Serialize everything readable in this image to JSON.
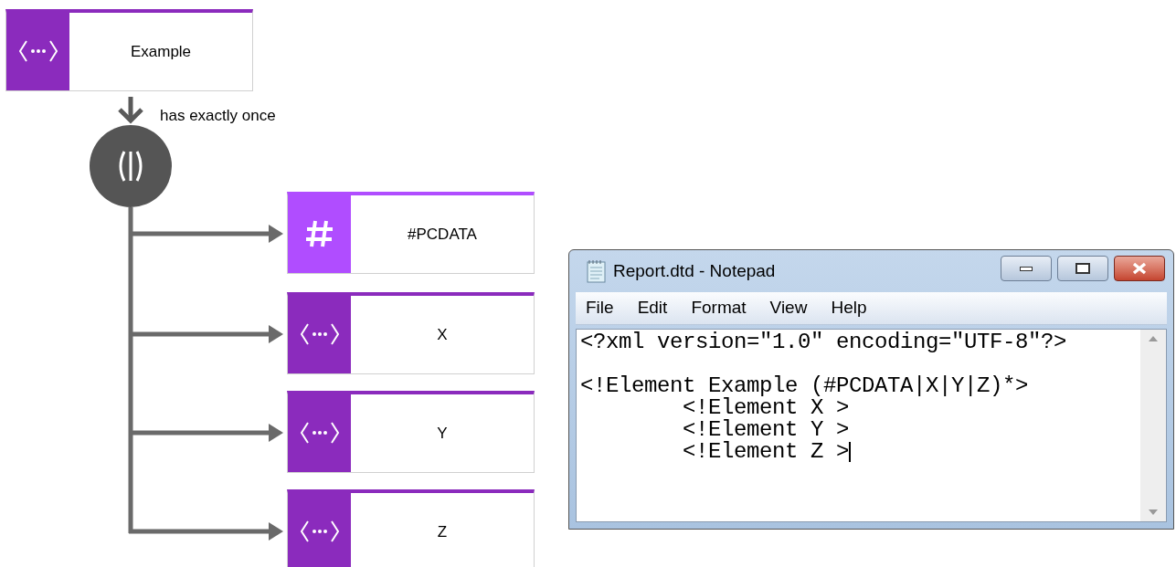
{
  "diagram": {
    "root": {
      "kind": "element",
      "label": "Example"
    },
    "connector_label": "has exactly once",
    "children": [
      {
        "kind": "text",
        "label": "#PCDATA"
      },
      {
        "kind": "element",
        "label": "X"
      },
      {
        "kind": "element",
        "label": "Y"
      },
      {
        "kind": "element",
        "label": "Z"
      }
    ]
  },
  "notepad": {
    "title": "Report.dtd - Notepad",
    "menu": [
      "File",
      "Edit",
      "Format",
      "View",
      "Help"
    ],
    "text": "<?xml version=\"1.0\" encoding=\"UTF-8\"?>\n\n<!Element Example (#PCDATA|X|Y|Z)*>\n        <!Element X >\n        <!Element Y >\n        <!Element Z >"
  }
}
